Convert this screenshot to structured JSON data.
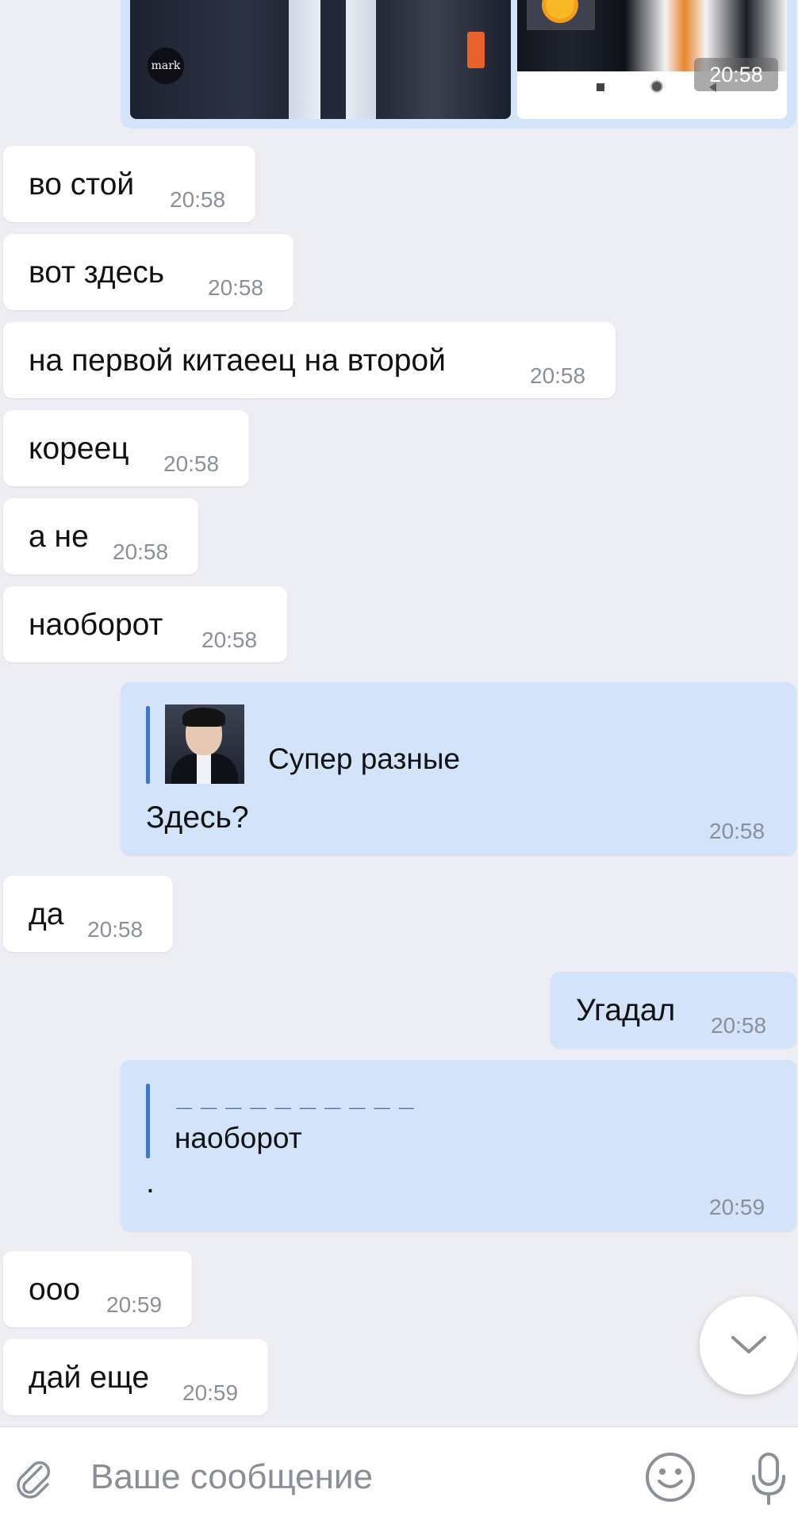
{
  "photo_message": {
    "logo_text": "mark",
    "time": "20:58"
  },
  "messages": [
    {
      "text": "во стой",
      "time": "20:58"
    },
    {
      "text": "вот здесь",
      "time": "20:58"
    },
    {
      "text": "на первой китаеец на второй",
      "time": "20:58"
    },
    {
      "text": "кореец",
      "time": "20:58"
    },
    {
      "text": "а не",
      "time": "20:58"
    },
    {
      "text": "наоборот",
      "time": "20:58"
    }
  ],
  "reply1": {
    "quoted_text": "Супер разные",
    "text": "Здесь?",
    "time": "20:58"
  },
  "msg_da": {
    "text": "да",
    "time": "20:58"
  },
  "msg_ugadal": {
    "text": "Угадал",
    "time": "20:58"
  },
  "reply2": {
    "quoted_text": "наоборот",
    "text": ".",
    "time": "20:59"
  },
  "msg_ooo": {
    "text": "ооо",
    "time": "20:59"
  },
  "msg_dai": {
    "text": "дай еще",
    "time": "20:59"
  },
  "input": {
    "placeholder": "Ваше сообщение",
    "value": ""
  },
  "icons": {
    "attach": "paperclip-icon",
    "emoji": "smiley-icon",
    "mic": "microphone-icon",
    "scroll": "chevron-down-icon"
  },
  "colors": {
    "background": "#edeef3",
    "incoming_bubble": "#ffffff",
    "outgoing_bubble": "#d3e3f9",
    "accent": "#3f76c5",
    "time_text": "#8a8f98"
  }
}
